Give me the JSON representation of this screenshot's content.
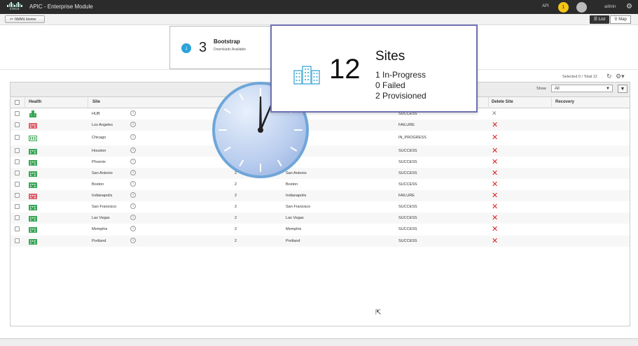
{
  "topbar": {
    "logo_text": "cisco",
    "title": "APIC - Enterprise Module",
    "api": "API",
    "notification_count": "1",
    "user": "admin"
  },
  "subbar": {
    "home_label": "IWAN Home",
    "list_label": "List",
    "map_label": "Map"
  },
  "bootstrap_card": {
    "count": "3",
    "title": "Bootstrap",
    "subtitle": "Downloads Available"
  },
  "sites_card": {
    "count": "12",
    "title": "Sites",
    "in_progress": "1 In-Progress",
    "failed": "0 Failed",
    "provisioned": "2 Provisioned"
  },
  "toolbar": {
    "selected": "Selected 0 / Total 12",
    "show_label": "Show",
    "show_value": "All"
  },
  "table": {
    "columns": {
      "health": "Health",
      "site": "Site",
      "delete_site": "Delete Site",
      "recovery": "Recovery"
    },
    "rows": [
      {
        "health": "hub",
        "site": "HUB",
        "count": "",
        "location": "",
        "status": "SUCCESS",
        "delete": "grey"
      },
      {
        "health": "fail",
        "site": "Los Angeles",
        "count": "",
        "location": "",
        "status": "FAILURE",
        "delete": "red"
      },
      {
        "health": "ok",
        "site": "Chicago",
        "count": "",
        "location": "",
        "status": "IN_PROGRESS",
        "delete": "red"
      },
      {
        "health": "ok",
        "site": "Houston",
        "count": "",
        "location": "",
        "status": "SUCCESS",
        "delete": "red"
      },
      {
        "health": "ok",
        "site": "Phoenix",
        "count": "",
        "location": "",
        "status": "SUCCESS",
        "delete": "red"
      },
      {
        "health": "ok",
        "site": "San Antonio",
        "count": "2",
        "location": "San Antonio",
        "status": "SUCCESS",
        "delete": "red"
      },
      {
        "health": "ok",
        "site": "Boston",
        "count": "2",
        "location": "Boston",
        "status": "SUCCESS",
        "delete": "red"
      },
      {
        "health": "fail",
        "site": "Indianapolis",
        "count": "2",
        "location": "Indianapolis",
        "status": "FAILURE",
        "delete": "red"
      },
      {
        "health": "ok",
        "site": "San Francisco",
        "count": "2",
        "location": "San Francisco",
        "status": "SUCCESS",
        "delete": "red"
      },
      {
        "health": "ok",
        "site": "Las Vegas",
        "count": "2",
        "location": "Las Vegas",
        "status": "SUCCESS",
        "delete": "red"
      },
      {
        "health": "ok",
        "site": "Memphis",
        "count": "2",
        "location": "Memphis",
        "status": "SUCCESS",
        "delete": "red"
      },
      {
        "health": "ok",
        "site": "Portland",
        "count": "2",
        "location": "Portland",
        "status": "SUCCESS",
        "delete": "red"
      }
    ]
  },
  "colors": {
    "healthy": "#3aa655",
    "failed": "#e0606a",
    "accent": "#2aa3d8",
    "delete": "#dd2222",
    "highlight_border": "#6f6fb0"
  },
  "icons": {
    "logo": "cisco-logo",
    "download": "download-icon",
    "building": "building-icon",
    "info": "info-icon",
    "delete": "delete-x-icon",
    "clock": "clock-overlay",
    "filter": "filter-icon",
    "refresh": "refresh-icon",
    "settings": "gear-icon"
  }
}
